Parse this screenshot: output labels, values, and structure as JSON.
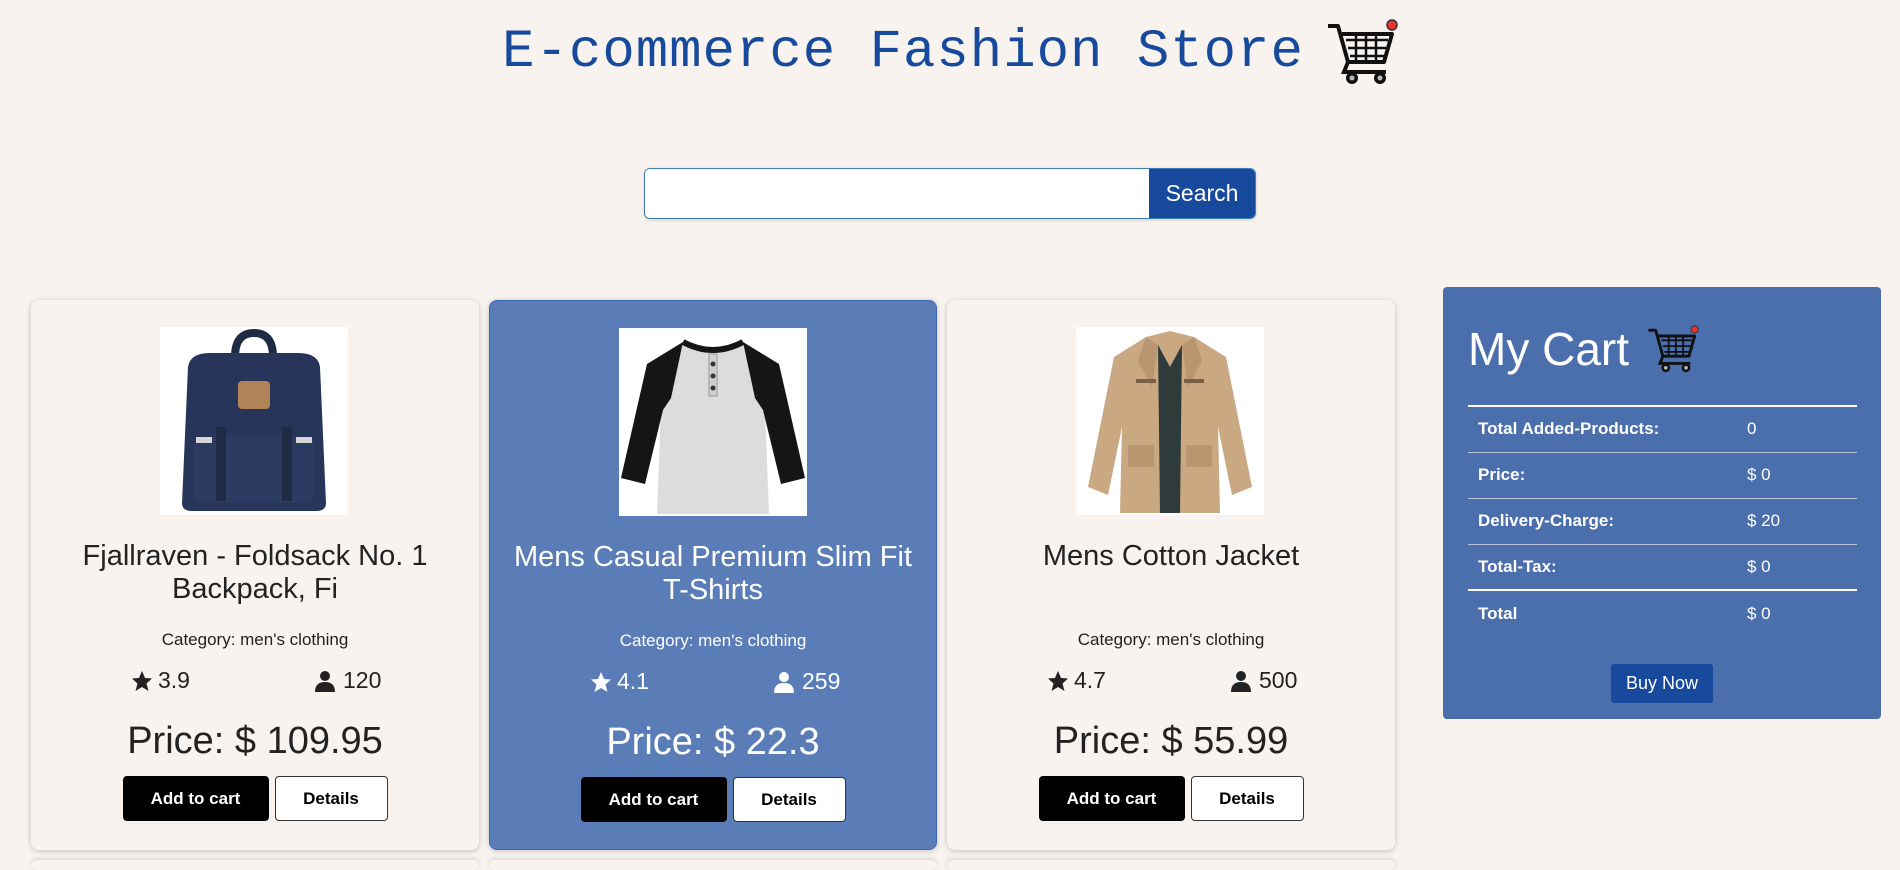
{
  "header": {
    "title": "E-commerce Fashion Store",
    "cart_icon": "shopping-cart-icon"
  },
  "search": {
    "placeholder": "",
    "value": "",
    "button_label": "Search"
  },
  "products": [
    {
      "title": "Fjallraven - Foldsack No. 1 Backpack, Fi",
      "category": "Category: men's clothing",
      "rating": "3.9",
      "count": "120",
      "price": "Price: $ 109.95",
      "add_label": "Add to cart",
      "details_label": "Details"
    },
    {
      "title": "Mens Casual Premium Slim Fit T-Shirts",
      "category": "Category: men's clothing",
      "rating": "4.1",
      "count": "259",
      "price": "Price: $ 22.3",
      "add_label": "Add to cart",
      "details_label": "Details"
    },
    {
      "title": "Mens Cotton Jacket",
      "category": "Category: men's clothing",
      "rating": "4.7",
      "count": "500",
      "price": "Price: $ 55.99",
      "add_label": "Add to cart",
      "details_label": "Details"
    }
  ],
  "cart": {
    "title": "My Cart",
    "rows": [
      {
        "label": "Total Added-Products:",
        "value": "0"
      },
      {
        "label": "Price:",
        "value": "$ 0"
      },
      {
        "label": "Delivery-Charge:",
        "value": "$ 20"
      },
      {
        "label": "Total-Tax:",
        "value": "$ 0"
      },
      {
        "label": "Total",
        "value": "$ 0"
      }
    ],
    "buy_label": "Buy Now"
  },
  "colors": {
    "accent": "#174a9c",
    "highlight_card": "#5a7db7",
    "cart_panel": "#4b6ead",
    "background": "#f8f3ef"
  }
}
